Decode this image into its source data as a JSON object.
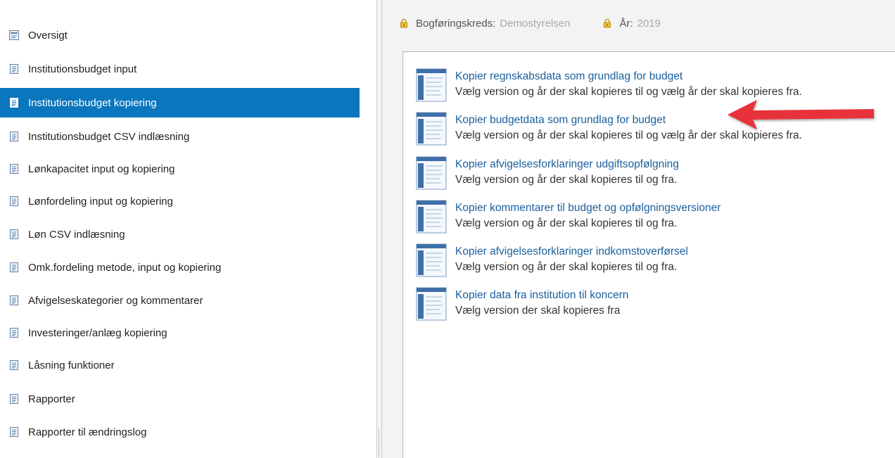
{
  "sidebar": {
    "items": [
      {
        "label": "Oversigt",
        "icon": "form-icon",
        "active": false
      },
      {
        "label": "Institutionsbudget input",
        "icon": "document-icon",
        "active": false
      },
      {
        "label": "Institutionsbudget kopiering",
        "icon": "document-icon",
        "active": true
      },
      {
        "label": "Institutionsbudget CSV indlæsning",
        "icon": "document-icon",
        "active": false
      },
      {
        "label": "Lønkapacitet input og kopiering",
        "icon": "document-icon",
        "active": false
      },
      {
        "label": "Lønfordeling input og kopiering",
        "icon": "document-icon",
        "active": false
      },
      {
        "label": "Løn CSV indlæsning",
        "icon": "document-icon",
        "active": false
      },
      {
        "label": "Omk.fordeling metode, input og kopiering",
        "icon": "document-icon",
        "active": false
      },
      {
        "label": "Afvigelseskategorier og kommentarer",
        "icon": "document-icon",
        "active": false
      },
      {
        "label": "Investeringer/anlæg kopiering",
        "icon": "document-icon",
        "active": false
      },
      {
        "label": "Låsning funktioner",
        "icon": "document-icon",
        "active": false
      },
      {
        "label": "Rapporter",
        "icon": "document-icon",
        "active": false
      },
      {
        "label": "Rapporter til ændringslog",
        "icon": "document-icon",
        "active": false
      }
    ]
  },
  "context": {
    "bogforingskreds_label": "Bogføringskreds:",
    "bogforingskreds_value": "Demostyrelsen",
    "aar_label": "År:",
    "aar_value": "2019"
  },
  "tasks": [
    {
      "title": "Kopier regnskabsdata som grundlag for budget",
      "desc": "Vælg version og år der skal kopieres til og vælg år der skal kopieres fra."
    },
    {
      "title": "Kopier budgetdata som grundlag for budget",
      "desc": "Vælg version og år der skal kopieres til og vælg år der skal kopieres fra."
    },
    {
      "title": "Kopier afvigelsesforklaringer udgiftsopfølgning",
      "desc": "Vælg version og år der skal kopieres til og fra."
    },
    {
      "title": "Kopier kommentarer til budget og opfølgningsversioner",
      "desc": "Vælg version og år der skal kopieres til og fra."
    },
    {
      "title": "Kopier afvigelsesforklaringer indkomstoverførsel",
      "desc": "Vælg version og år der skal kopieres til og fra."
    },
    {
      "title": "Kopier data fra institution til koncern",
      "desc": "Vælg version der skal kopieres fra"
    }
  ],
  "colors": {
    "active_bg": "#0a76bd",
    "link": "#1a5f9e",
    "annotation_arrow": "#e8333a"
  }
}
